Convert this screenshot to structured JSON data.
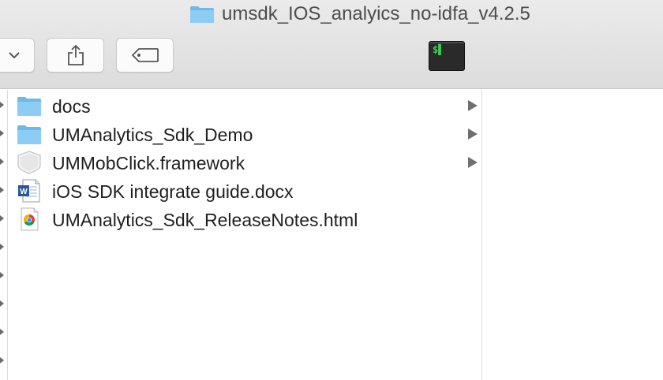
{
  "window": {
    "title": "umsdk_IOS_analyics_no-idfa_v4.2.5",
    "title_icon": "folder-icon"
  },
  "toolbar": {
    "back_icon": "chevron-down-icon",
    "share_icon": "share-icon",
    "tag_icon": "tag-icon",
    "terminal_icon": "terminal-icon",
    "terminal_glyph": "$▌"
  },
  "files": [
    {
      "name": "docs",
      "kind": "folder",
      "has_children": true
    },
    {
      "name": "UMAnalytics_Sdk_Demo",
      "kind": "folder",
      "has_children": true
    },
    {
      "name": "UMMobClick.framework",
      "kind": "framework",
      "has_children": true
    },
    {
      "name": "iOS SDK integrate guide.docx",
      "kind": "word-document",
      "has_children": false
    },
    {
      "name": "UMAnalytics_Sdk_ReleaseNotes.html",
      "kind": "chrome-html",
      "has_children": false
    }
  ],
  "colors": {
    "folder": "#7cc3f0",
    "toolbar_bg": "#e3e3e3",
    "selection_none": "#ffffff"
  }
}
